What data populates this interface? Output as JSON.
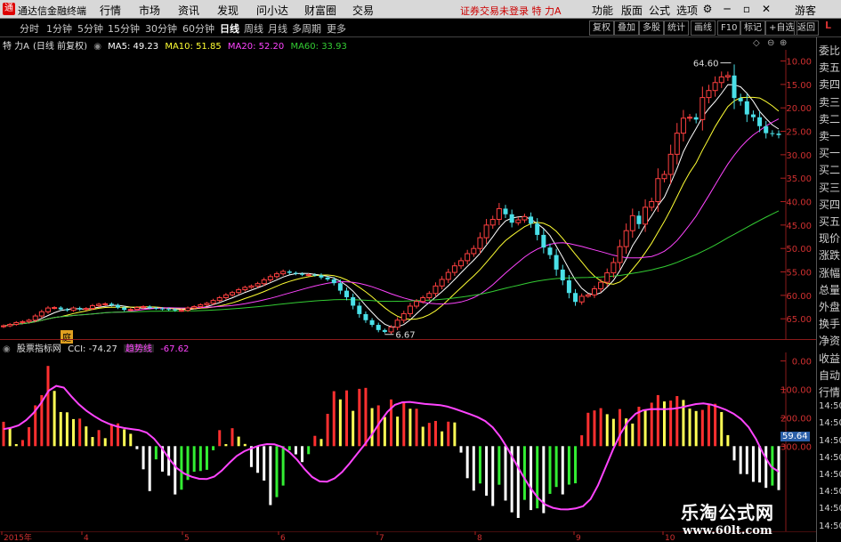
{
  "menubar": {
    "app_title": "通达信金融终端",
    "items": [
      "行情",
      "市场",
      "资讯",
      "发现",
      "问小达",
      "财富圈",
      "交易"
    ],
    "notice": "证券交易未登录  特 力A",
    "right_items": [
      "功能",
      "版面",
      "公式",
      "选项",
      "游客"
    ]
  },
  "periodbar": {
    "items": [
      "分时",
      "1分钟",
      "5分钟",
      "15分钟",
      "30分钟",
      "60分钟",
      "日线",
      "周线",
      "月线",
      "多周期",
      "更多"
    ],
    "active": "日线",
    "right_tools": [
      "复权",
      "叠加",
      "多股",
      "统计",
      "画线",
      "F10",
      "标记",
      "+自选",
      "返回"
    ]
  },
  "main_chart": {
    "stock_label": "特 力A",
    "period_label": "(日线 前复权)",
    "ma_items": [
      {
        "text": "MA5: 49.23",
        "color": "#ffffff"
      },
      {
        "text": "MA10: 51.85",
        "color": "#ffff33"
      },
      {
        "text": "MA20: 52.20",
        "color": "#ff44ff"
      },
      {
        "text": "MA60: 33.93",
        "color": "#33cc33"
      }
    ],
    "high_label": "64.60",
    "low_label": "6.67",
    "marker_label": "庭",
    "y_ticks": [
      "65.00",
      "60.00",
      "55.00",
      "50.00",
      "45.00",
      "40.00",
      "35.00",
      "30.00",
      "25.00",
      "20.00",
      "15.00",
      "10.00"
    ]
  },
  "indicator": {
    "name": "股票指标网",
    "cci_text": "CCI: -74.27",
    "trend_label": "趋势线",
    "trend_value": "-67.62",
    "current_tag": "59.64",
    "y_ticks": [
      "300.00",
      "200.00",
      "100.00",
      "0.00"
    ]
  },
  "x_axis": {
    "labels": [
      "2015年",
      "4",
      "5",
      "6",
      "7",
      "8",
      "9",
      "10"
    ]
  },
  "right_panel": {
    "items": [
      "委比",
      "卖五",
      "卖四",
      "卖三",
      "卖二",
      "卖一",
      "买一",
      "买二",
      "买三",
      "买四",
      "买五",
      "现价",
      "涨跌",
      "涨幅",
      "总量",
      "外盘",
      "换手",
      "净资",
      "收益",
      "自动",
      "行情",
      "14:50",
      "14:50",
      "14:50",
      "14:50",
      "14:50",
      "14:50",
      "14:50",
      "14:50"
    ],
    "top_letter": "L"
  },
  "watermark": {
    "line1": "乐淘公式网",
    "line2": "www.60lt.com"
  },
  "chart_data": [
    {
      "type": "candlestick",
      "title": "特 力A (日线 前复权)",
      "x_labels": [
        "2015年",
        "4",
        "5",
        "6",
        "7",
        "8",
        "9",
        "10"
      ],
      "ylim": [
        7,
        67
      ],
      "y_ticks": [
        10,
        15,
        20,
        25,
        30,
        35,
        40,
        45,
        50,
        55,
        60,
        65
      ],
      "close": [
        8.5,
        8.8,
        9.2,
        9.4,
        9.7,
        10.6,
        11.5,
        12.3,
        12.4,
        12.0,
        11.8,
        12.3,
        12.0,
        12.2,
        12.8,
        13.1,
        13.2,
        12.9,
        12.4,
        11.9,
        12.0,
        12.4,
        12.6,
        12.3,
        12.2,
        12.1,
        12.0,
        11.8,
        11.8,
        12.3,
        12.6,
        13.0,
        13.3,
        13.9,
        14.5,
        15.1,
        15.6,
        16.2,
        16.7,
        17.0,
        17.5,
        18.3,
        19.0,
        19.6,
        20.1,
        19.8,
        19.6,
        19.4,
        19.4,
        19.3,
        18.8,
        18.4,
        17.6,
        16.0,
        14.6,
        12.8,
        11.0,
        9.7,
        8.7,
        7.6,
        7.2,
        8.2,
        9.7,
        11.1,
        12.7,
        13.7,
        14.5,
        15.4,
        17.0,
        18.4,
        19.9,
        21.3,
        22.4,
        23.9,
        25.0,
        27.3,
        30.0,
        31.2,
        33.5,
        32.3,
        30.5,
        31.1,
        31.8,
        30.3,
        27.9,
        25.2,
        23.6,
        20.5,
        18.2,
        15.5,
        13.6,
        14.8,
        15.1,
        16.4,
        17.8,
        19.8,
        22.0,
        25.4,
        28.8,
        32.0,
        30.2,
        33.8,
        35.0,
        39.9,
        40.8,
        45.1,
        49.6,
        52.8,
        53.0,
        52.5,
        57.2,
        58.7,
        60.4,
        61.6,
        61.9,
        57.1,
        56.4,
        53.6,
        53.0,
        51.1,
        49.6,
        49.5,
        49.2
      ],
      "ma_current": {
        "MA5": 49.23,
        "MA10": 51.85,
        "MA20": 52.2,
        "MA60": 33.93
      },
      "high_point": 64.6,
      "low_point": 6.67
    },
    {
      "type": "bar",
      "title": "CCI",
      "ylim": [
        -300,
        330
      ],
      "y_ticks": [
        0,
        100,
        200,
        300
      ],
      "values": [
        85.8,
        64.6,
        7.2,
        21.4,
        66.6,
        143.6,
        179.6,
        282.4,
        194.4,
        120.1,
        119.1,
        95.2,
        97.0,
        69.5,
        32.1,
        56.5,
        28.0,
        76.4,
        80.0,
        59.2,
        43.5,
        -10.6,
        -81.6,
        -158.3,
        -46.6,
        -89.7,
        -104.0,
        -170.2,
        -153.4,
        -119.1,
        -90.2,
        -87.6,
        -83.4,
        -14.6,
        56.3,
        7.2,
        63.1,
        33.5,
        7.7,
        -73.6,
        -94.0,
        -121.3,
        -207.6,
        -179.6,
        -138.9,
        -14.6,
        -29.0,
        -56.2,
        -28.3,
        36.3,
        25.1,
        113.8,
        193.5,
        164.6,
        196.3,
        124.3,
        201.8,
        205.2,
        133.8,
        143.6,
        102.7,
        164.4,
        104.0,
        157.2,
        131.6,
        131.6,
        68.3,
        81.9,
        88.7,
        52.0,
        86.2,
        83.4,
        -22.8,
        -112.9,
        -156.7,
        -131.6,
        -174.4,
        -210.8,
        -136.0,
        -191.7,
        -233.1,
        -252.9,
        -189.3,
        -225.1,
        -219.1,
        -236.0,
        -168.1,
        -143.9,
        -170.0,
        -135.6,
        -130.9,
        38.3,
        117.5,
        125.7,
        133.8,
        112.5,
        96.1,
        130.5,
        97.6,
        79.5,
        138.8,
        124.9,
        153.0,
        179.8,
        157.4,
        160.4,
        176.3,
        162.6,
        132.2,
        123.7,
        127.6,
        146.1,
        149.1,
        120.1,
        38.8,
        -50.2,
        -98.1,
        -98.6,
        -125.7,
        -128.0,
        -146.9,
        -138.9,
        -154.8
      ],
      "trend": [
        59.9,
        64.8,
        73.1,
        91.4,
        117.1,
        152.4,
        195.3,
        212.3,
        206.1,
        175.6,
        147.3,
        125.1,
        106.4,
        90.6,
        78.6,
        70.0,
        63.8,
        60.1,
        56.6,
        47.8,
        26.4,
        -5.9,
        -44.2,
        -76.7,
        -96.6,
        -107.8,
        -115.1,
        -116.0,
        -107.1,
        -86.1,
        -59.0,
        -34.6,
        -18.0,
        -6.9,
        2.1,
        7.2,
        6.2,
        -3.0,
        -21.1,
        -48.1,
        -80.8,
        -108.4,
        -124.2,
        -125.0,
        -113.3,
        -91.0,
        -60.2,
        -27.1,
        6.2,
        43.2,
        84.4,
        120.6,
        145.3,
        154.6,
        155.6,
        151.9,
        148.6,
        146.6,
        144.5,
        139.1,
        130.9,
        122.0,
        112.5,
        102.0,
        88.3,
        66.1,
        33.0,
        -9.5,
        -57.4,
        -104.0,
        -146.4,
        -182.0,
        -206.3,
        -217.1,
        -222.2,
        -222.9,
        -219.5,
        -211.5,
        -186.4,
        -137.6,
        -74.4,
        -10.8,
        44.4,
        87.3,
        114.3,
        126.4,
        130.4,
        130.6,
        130.2,
        132.0,
        136.1,
        142.1,
        148.3,
        150.3,
        146.3,
        137.8,
        127.8,
        114.4,
        95.3,
        66.8,
        24.3,
        -29.6,
        -72.5,
        -90.0
      ],
      "current_cci": -74.27,
      "current_trend": -67.62
    }
  ]
}
